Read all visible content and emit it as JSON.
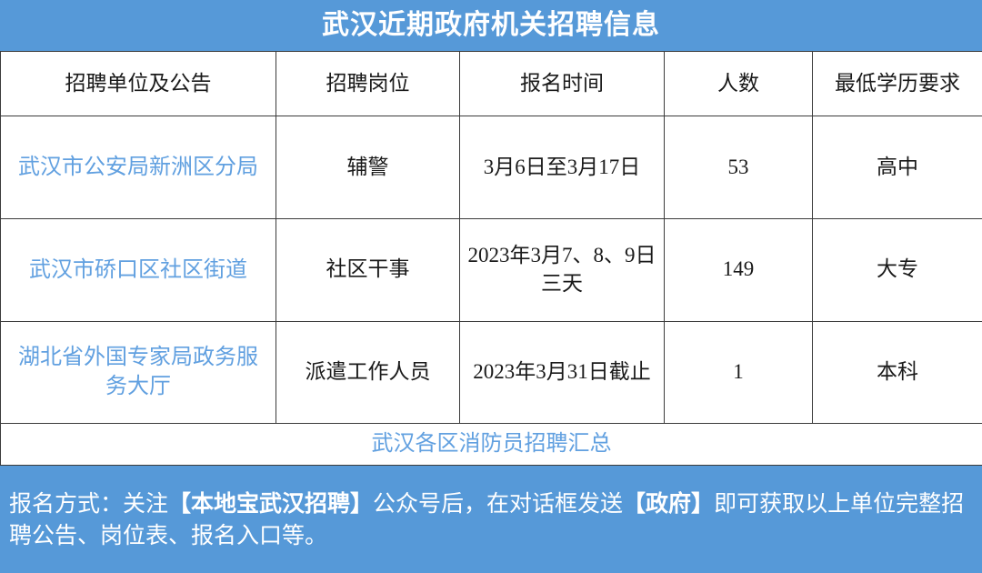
{
  "header": {
    "title": "武汉近期政府机关招聘信息",
    "background_color": "#5699D8",
    "text_color": "#ffffff"
  },
  "table": {
    "columns": [
      "招聘单位及公告",
      "招聘岗位",
      "报名时间",
      "人数",
      "最低学历要求"
    ],
    "link_color": "#61A0E0",
    "rows": [
      {
        "org": "武汉市公安局新洲区分局",
        "position": "辅警",
        "signup_time": "3月6日至3月17日",
        "count": "53",
        "education": "高中"
      },
      {
        "org": "武汉市硚口区社区街道",
        "position": "社区干事",
        "signup_time": "2023年3月7、8、9日三天",
        "count": "149",
        "education": "大专"
      },
      {
        "org": "湖北省外国专家局政务服务大厅",
        "position": "派遣工作人员",
        "signup_time": "2023年3月31日截止",
        "count": "1",
        "education": "本科"
      }
    ],
    "summary_link": "武汉各区消防员招聘汇总"
  },
  "footer": {
    "background_color": "#5699D8",
    "text_color": "#ffffff",
    "note_parts": {
      "p1": "报名方式：关注",
      "p2": "【本地宝武汉招聘】",
      "p3": "公众号后，在对话框发送",
      "p4": "【政府】",
      "p5": "即可获取以上单位完整招聘公告、岗位表、报名入口等。"
    },
    "note_full": "报名方式：关注【本地宝武汉招聘】公众号后，在对话框发送【政府】即可获取以上单位完整招聘公告、岗位表、报名入口等。"
  }
}
